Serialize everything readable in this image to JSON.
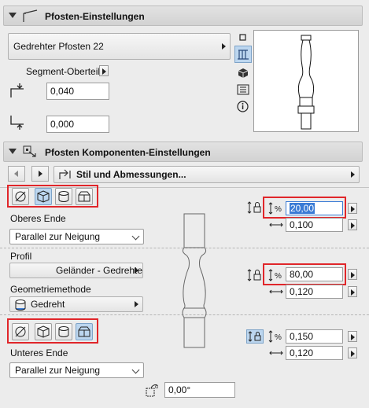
{
  "section1": {
    "title": "Pfosten-Einstellungen"
  },
  "post_type": {
    "label": "Gedrehter Pfosten 22"
  },
  "segment": {
    "label": "Segment-Oberteil"
  },
  "top_offset": {
    "value": "0,040"
  },
  "bottom_offset": {
    "value": "0,000"
  },
  "section2": {
    "title": "Pfosten Komponenten-Einstellungen"
  },
  "panel_nav": {
    "label": "Stil und Abmessungen..."
  },
  "upper_end": {
    "label": "Oberes Ende",
    "select_value": "Parallel zur Neigung"
  },
  "profile": {
    "label": "Profil",
    "value": "Geländer - Gedrehter-..."
  },
  "geometry": {
    "label": "Geometriemethode",
    "value": "Gedreht"
  },
  "lower_end": {
    "label": "Unteres Ende",
    "select_value": "Parallel zur Neigung"
  },
  "dims": {
    "top_height": "20,00",
    "top_width": "0,100",
    "mid_height": "80,00",
    "mid_width": "0,120",
    "bottom_height": "0,150",
    "bottom_width": "0,120"
  },
  "rotation": {
    "value": "0,00°"
  },
  "colors": {
    "highlight_red": "#e0262a",
    "active_blue": "#bcd6ef",
    "selection_blue": "#3a7bd5"
  }
}
